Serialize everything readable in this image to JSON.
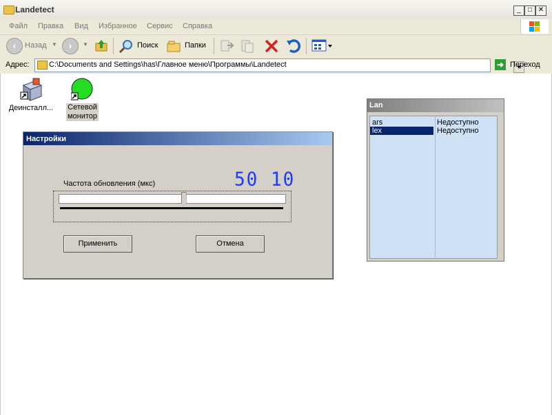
{
  "window": {
    "title": "Landetect"
  },
  "menu": [
    "Файл",
    "Правка",
    "Вид",
    "Избранное",
    "Сервис",
    "Справка"
  ],
  "toolbar": {
    "back_label": "Назад",
    "search_label": "Поиск",
    "folders_label": "Папки"
  },
  "address": {
    "label": "Адрес:",
    "path": "C:\\Documents and Settings\\has\\Главное меню\\Программы\\Landetect",
    "go_label": "Переход"
  },
  "desktop_icons": [
    {
      "label": "Деинсталл...",
      "icon": "uninstall-icon"
    },
    {
      "label": "Сетевой монитор",
      "icon": "network-monitor-icon",
      "label_line1": "Сетевой",
      "label_line2": "монитор"
    }
  ],
  "settings_dialog": {
    "title": "Настройки",
    "frequency_label": "Частота обновления (мкс)",
    "frequency_value": "50 10",
    "slider_fraction": 0.55,
    "apply_label": "Применить",
    "cancel_label": "Отмена"
  },
  "lan_window": {
    "title": "Lan",
    "rows": [
      {
        "name": "ars",
        "status": "Недоступно",
        "selected": false
      },
      {
        "name": "lex",
        "status": "Недоступно",
        "selected": true
      }
    ]
  },
  "colors": {
    "dialog_title_start": "#0a246a",
    "selection": "#0a246a",
    "lan_list_bg": "#cfe1f5",
    "lcd_digits": "#1a3cff",
    "network_icon": "#22dd22"
  }
}
